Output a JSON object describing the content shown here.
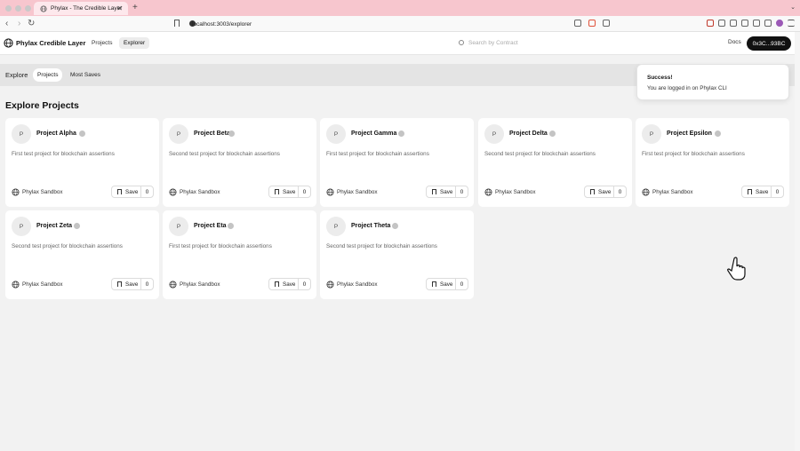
{
  "browser": {
    "tab_title": "Phylax - The Credible Layer",
    "tab_close": "✕",
    "new_tab": "+",
    "tab_menu": "⌄",
    "url": "localhost:3003/explorer",
    "back": "‹",
    "forward": "›",
    "reload": "↻"
  },
  "header": {
    "brand": "Phylax Credible Layer",
    "nav": [
      "Projects",
      "Explorer"
    ],
    "search_placeholder": "Search by Contract",
    "docs": "Docs",
    "wallet": "0x3C...93BC"
  },
  "subheader": {
    "title": "Explore",
    "filters": [
      "Projects",
      "Most Saves"
    ]
  },
  "page_title": "Explore Projects",
  "toast": {
    "title": "Success!",
    "message": "You are logged in on Phylax CLI"
  },
  "projects": [
    {
      "avatar": "P",
      "name": "Project Alpha",
      "desc": "First test project for blockchain assertions",
      "network": "Phylax Sandbox",
      "save": "Save",
      "count": "0"
    },
    {
      "avatar": "P",
      "name": "Project Beta",
      "desc": "Second test project for blockchain assertions",
      "network": "Phylax Sandbox",
      "save": "Save",
      "count": "0"
    },
    {
      "avatar": "P",
      "name": "Project Gamma",
      "desc": "First test project for blockchain assertions",
      "network": "Phylax Sandbox",
      "save": "Save",
      "count": "0"
    },
    {
      "avatar": "P",
      "name": "Project Delta",
      "desc": "Second test project for blockchain assertions",
      "network": "Phylax Sandbox",
      "save": "Save",
      "count": "0"
    },
    {
      "avatar": "P",
      "name": "Project Epsilon",
      "desc": "First test project for blockchain assertions",
      "network": "Phylax Sandbox",
      "save": "Save",
      "count": "0"
    },
    {
      "avatar": "P",
      "name": "Project Zeta",
      "desc": "Second test project for blockchain assertions",
      "network": "Phylax Sandbox",
      "save": "Save",
      "count": "0"
    },
    {
      "avatar": "P",
      "name": "Project Eta",
      "desc": "First test project for blockchain assertions",
      "network": "Phylax Sandbox",
      "save": "Save",
      "count": "0"
    },
    {
      "avatar": "P",
      "name": "Project Theta",
      "desc": "Second test project for blockchain assertions",
      "network": "Phylax Sandbox",
      "save": "Save",
      "count": "0"
    }
  ],
  "colors": {
    "tabbar": "#f7c6ce",
    "wallet_bg": "#111111",
    "page_bg": "#f2f2f2"
  }
}
